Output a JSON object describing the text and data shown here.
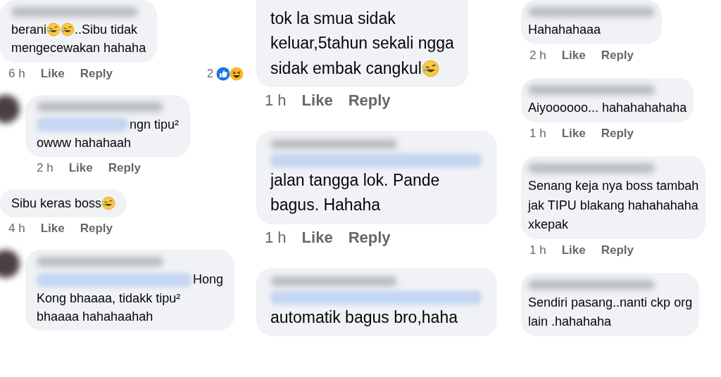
{
  "columns": [
    {
      "comments": [
        {
          "avatar": false,
          "cut_top": false,
          "name_hidden": true,
          "lines": [
            [
              {
                "kind": "text",
                "text": "berani"
              },
              {
                "kind": "emoji"
              },
              {
                "kind": "emoji"
              },
              {
                "kind": "text",
                "text": "..Sibu tidak"
              }
            ],
            [
              {
                "kind": "text",
                "text": "mengecewakan hahaha"
              }
            ]
          ],
          "time": "6 h",
          "like": "Like",
          "reply": "Reply",
          "reactions": {
            "count": "2"
          }
        },
        {
          "avatar": true,
          "cut_top": false,
          "name_hidden": true,
          "lines": [
            [
              {
                "kind": "mention"
              },
              {
                "kind": "text",
                "text": "ngn tipu²"
              }
            ],
            [
              {
                "kind": "text",
                "text": "owww hahahaah"
              }
            ]
          ],
          "time": "2 h",
          "like": "Like",
          "reply": "Reply"
        },
        {
          "avatar": false,
          "cut_top": false,
          "name_hidden": false,
          "lines": [
            [
              {
                "kind": "text",
                "text": "Sibu keras boss"
              },
              {
                "kind": "emoji"
              }
            ]
          ],
          "time": "4 h",
          "like": "Like",
          "reply": "Reply"
        },
        {
          "avatar": true,
          "cut_top": false,
          "name_hidden": true,
          "lines": [
            [
              {
                "kind": "mention"
              },
              {
                "kind": "text",
                "text": "Hong"
              }
            ],
            [
              {
                "kind": "text",
                "text": "Kong bhaaaa, tidakk tipu²"
              }
            ],
            [
              {
                "kind": "text",
                "text": "bhaaaa hahahaahah"
              }
            ]
          ]
        }
      ]
    },
    {
      "comments": [
        {
          "avatar": false,
          "cut_top": true,
          "name_hidden": false,
          "lines": [
            [
              {
                "kind": "text",
                "text": "tok la smua sidak"
              }
            ],
            [
              {
                "kind": "text",
                "text": "keluar,5tahun sekali ngga"
              }
            ],
            [
              {
                "kind": "text",
                "text": "sidak embak cangkul"
              },
              {
                "kind": "emoji"
              }
            ]
          ],
          "time": "1 h",
          "like": "Like",
          "reply": "Reply"
        },
        {
          "avatar": false,
          "cut_top": false,
          "name_hidden": true,
          "lines": [
            [
              {
                "kind": "mention"
              }
            ],
            [
              {
                "kind": "text",
                "text": "jalan tangga lok. Pande"
              }
            ],
            [
              {
                "kind": "text",
                "text": "bagus. Hahaha"
              }
            ]
          ],
          "time": "1 h",
          "like": "Like",
          "reply": "Reply"
        },
        {
          "avatar": false,
          "cut_top": false,
          "name_hidden": true,
          "lines": [
            [
              {
                "kind": "mention"
              }
            ],
            [
              {
                "kind": "text",
                "text": "automatik bagus bro,haha"
              }
            ]
          ]
        }
      ]
    },
    {
      "comments": [
        {
          "avatar": false,
          "cut_top": false,
          "name_hidden": true,
          "lines": [
            [
              {
                "kind": "text",
                "text": "Hahahahaaa"
              }
            ]
          ],
          "time": "2 h",
          "like": "Like",
          "reply": "Reply"
        },
        {
          "avatar": false,
          "cut_top": false,
          "name_hidden": true,
          "lines": [
            [
              {
                "kind": "text",
                "text": "Aiyoooooo... hahahahahaha"
              }
            ]
          ],
          "time": "1 h",
          "like": "Like",
          "reply": "Reply"
        },
        {
          "avatar": false,
          "cut_top": false,
          "name_hidden": true,
          "lines": [
            [
              {
                "kind": "text",
                "text": "Senang keja nya boss tambah"
              }
            ],
            [
              {
                "kind": "text",
                "text": "jak TIPU blakang hahahahaha"
              }
            ],
            [
              {
                "kind": "text",
                "text": "xkepak"
              }
            ]
          ],
          "time": "1 h",
          "like": "Like",
          "reply": "Reply"
        },
        {
          "avatar": false,
          "cut_top": false,
          "name_hidden": true,
          "lines": [
            [
              {
                "kind": "text",
                "text": "Sendiri pasang..nanti ckp org"
              }
            ],
            [
              {
                "kind": "text",
                "text": "lain .hahahaha"
              }
            ]
          ]
        }
      ]
    }
  ]
}
